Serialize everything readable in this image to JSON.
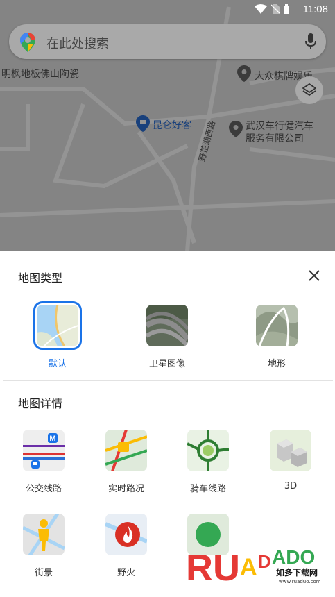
{
  "status_bar": {
    "time": "11:08"
  },
  "search": {
    "placeholder": "在此处搜索"
  },
  "map": {
    "pois": [
      {
        "name": "明枫地板佛山陶瓷",
        "color": "gray"
      },
      {
        "name": "大众棋牌娱乐",
        "color": "gray"
      },
      {
        "name": "昆仑好客",
        "color": "blue"
      },
      {
        "name": "武汉车行健汽车",
        "color": "gray"
      },
      {
        "name": "服务有限公司",
        "color": "gray"
      },
      {
        "name": "野芷湖西路",
        "color": "gray"
      }
    ]
  },
  "map_types": {
    "title": "地图类型",
    "items": [
      {
        "label": "默认",
        "icon": "default-map-thumbnail",
        "selected": true
      },
      {
        "label": "卫星图像",
        "icon": "satellite-map-thumbnail",
        "selected": false
      },
      {
        "label": "地形",
        "icon": "terrain-map-thumbnail",
        "selected": false
      }
    ]
  },
  "map_details": {
    "title": "地图详情",
    "items": [
      {
        "label": "公交线路",
        "icon": "transit-icon"
      },
      {
        "label": "实时路况",
        "icon": "traffic-icon"
      },
      {
        "label": "骑车线路",
        "icon": "biking-icon"
      },
      {
        "label": "3D",
        "icon": "3d-buildings-icon"
      },
      {
        "label": "街景",
        "icon": "street-view-icon"
      },
      {
        "label": "野火",
        "icon": "wildfire-icon"
      },
      {
        "label": "",
        "icon": "air-quality-icon"
      }
    ]
  },
  "watermark": {
    "logo": "RUADADO",
    "subtitle": "如多下载网",
    "url": "www.ruaduo.com"
  },
  "colors": {
    "accent": "#1a73e8",
    "scrim": "rgba(0,0,0,0.42)"
  }
}
